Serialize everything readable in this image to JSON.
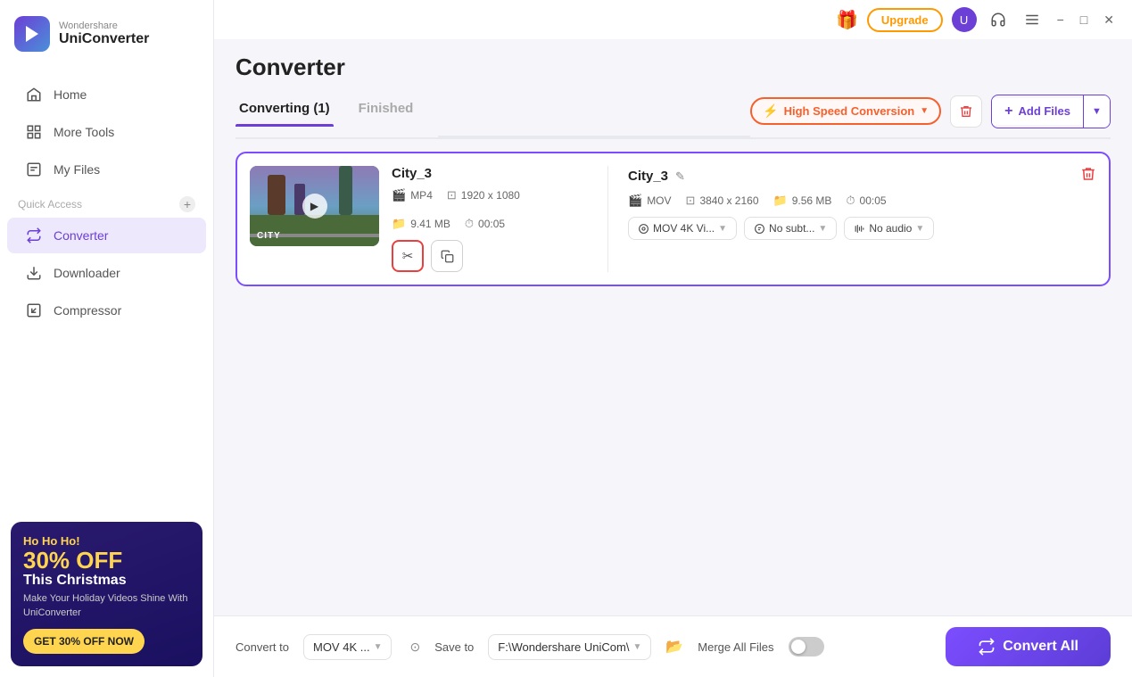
{
  "app": {
    "brand": "Wondershare",
    "product": "UniConverter"
  },
  "titlebar": {
    "upgrade_label": "Upgrade",
    "minimize": "−",
    "maximize": "□",
    "close": "✕"
  },
  "sidebar": {
    "nav_items": [
      {
        "id": "home",
        "label": "Home",
        "icon": "home"
      },
      {
        "id": "more-tools",
        "label": "More Tools",
        "icon": "grid"
      },
      {
        "id": "my-files",
        "label": "My Files",
        "icon": "file"
      }
    ],
    "quick_access_label": "Quick Access",
    "quick_access_plus": "+",
    "converter_label": "Converter",
    "bottom_nav": [
      {
        "id": "downloader",
        "label": "Downloader",
        "icon": "download"
      },
      {
        "id": "compressor",
        "label": "Compressor",
        "icon": "compress"
      }
    ]
  },
  "promo": {
    "ho": "Ho Ho Ho!",
    "off": "30% OFF",
    "this": "This Christmas",
    "desc": "Make Your Holiday Videos Shine With UniConverter",
    "btn": "GET 30% OFF NOW"
  },
  "page": {
    "title": "Converter"
  },
  "tabs": [
    {
      "id": "converting",
      "label": "Converting (1)",
      "active": true
    },
    {
      "id": "finished",
      "label": "Finished",
      "active": false
    }
  ],
  "toolbar": {
    "high_speed": "High Speed Conversion",
    "add_files": "Add Files"
  },
  "file_card": {
    "source_name": "City_3",
    "source_format": "MP4",
    "source_resolution": "1920 x 1080",
    "source_size": "9.41 MB",
    "source_duration": "00:05",
    "output_name": "City_3",
    "output_format": "MOV",
    "output_resolution": "3840 x 2160",
    "output_size": "9.56 MB",
    "output_duration": "00:05",
    "format_preset": "MOV 4K Vi...",
    "subtitle": "No subt...",
    "audio": "No audio"
  },
  "bottom": {
    "convert_to_label": "Convert to",
    "convert_to_value": "MOV 4K ...",
    "save_to_label": "Save to",
    "save_to_value": "F:\\Wondershare UniCom\\",
    "merge_label": "Merge All Files",
    "convert_all": "Convert All"
  }
}
